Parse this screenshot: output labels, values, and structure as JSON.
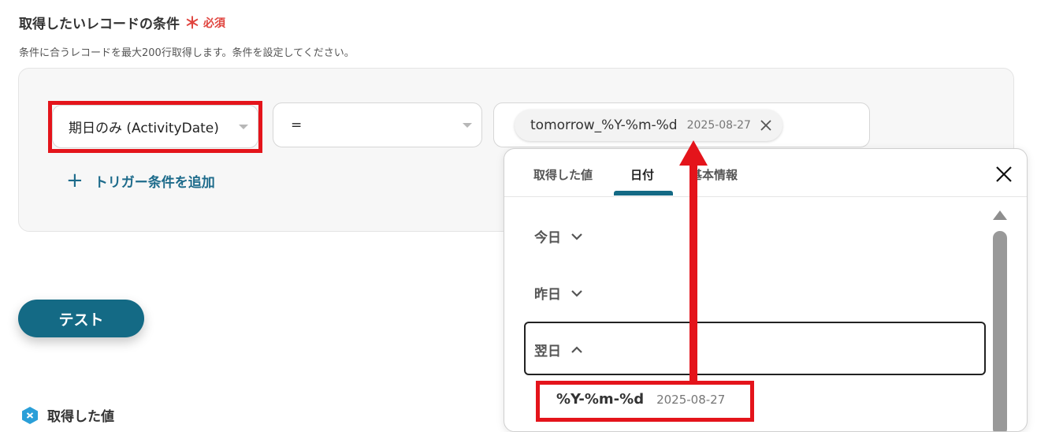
{
  "header": {
    "title": "取得したいレコードの条件",
    "required_star": "＊",
    "required_label": "必須",
    "description": "条件に合うレコードを最大200行取得します。条件を設定してください。"
  },
  "condition": {
    "field_value": "期日のみ (ActivityDate)",
    "operator_value": "=",
    "token": {
      "name": "tomorrow_%Y-%m-%d",
      "date": "2025-08-27"
    }
  },
  "add_trigger": {
    "plus": "+",
    "label": "トリガー条件を追加"
  },
  "test_button": {
    "label": "テスト"
  },
  "output": {
    "label": "取得した値"
  },
  "dropdown": {
    "tabs": [
      "取得した値",
      "日付",
      "基本情報"
    ],
    "active_tab": "日付",
    "groups": [
      {
        "label": "今日",
        "expanded": false
      },
      {
        "label": "昨日",
        "expanded": false
      },
      {
        "label": "翌日",
        "expanded": true
      }
    ],
    "options": [
      {
        "name": "%Y-%m-%d",
        "date": "2025-08-27"
      }
    ]
  },
  "colors": {
    "accent": "#146a85",
    "link": "#1d6b8b",
    "highlight": "#e4141b",
    "required": "#e0443e"
  },
  "icons": [
    "caret-down-icon",
    "close-icon",
    "plus-icon",
    "chevron-down-icon",
    "chevron-up-icon",
    "scroll-up-icon",
    "output-hex-icon",
    "up-arrow-annotation"
  ]
}
